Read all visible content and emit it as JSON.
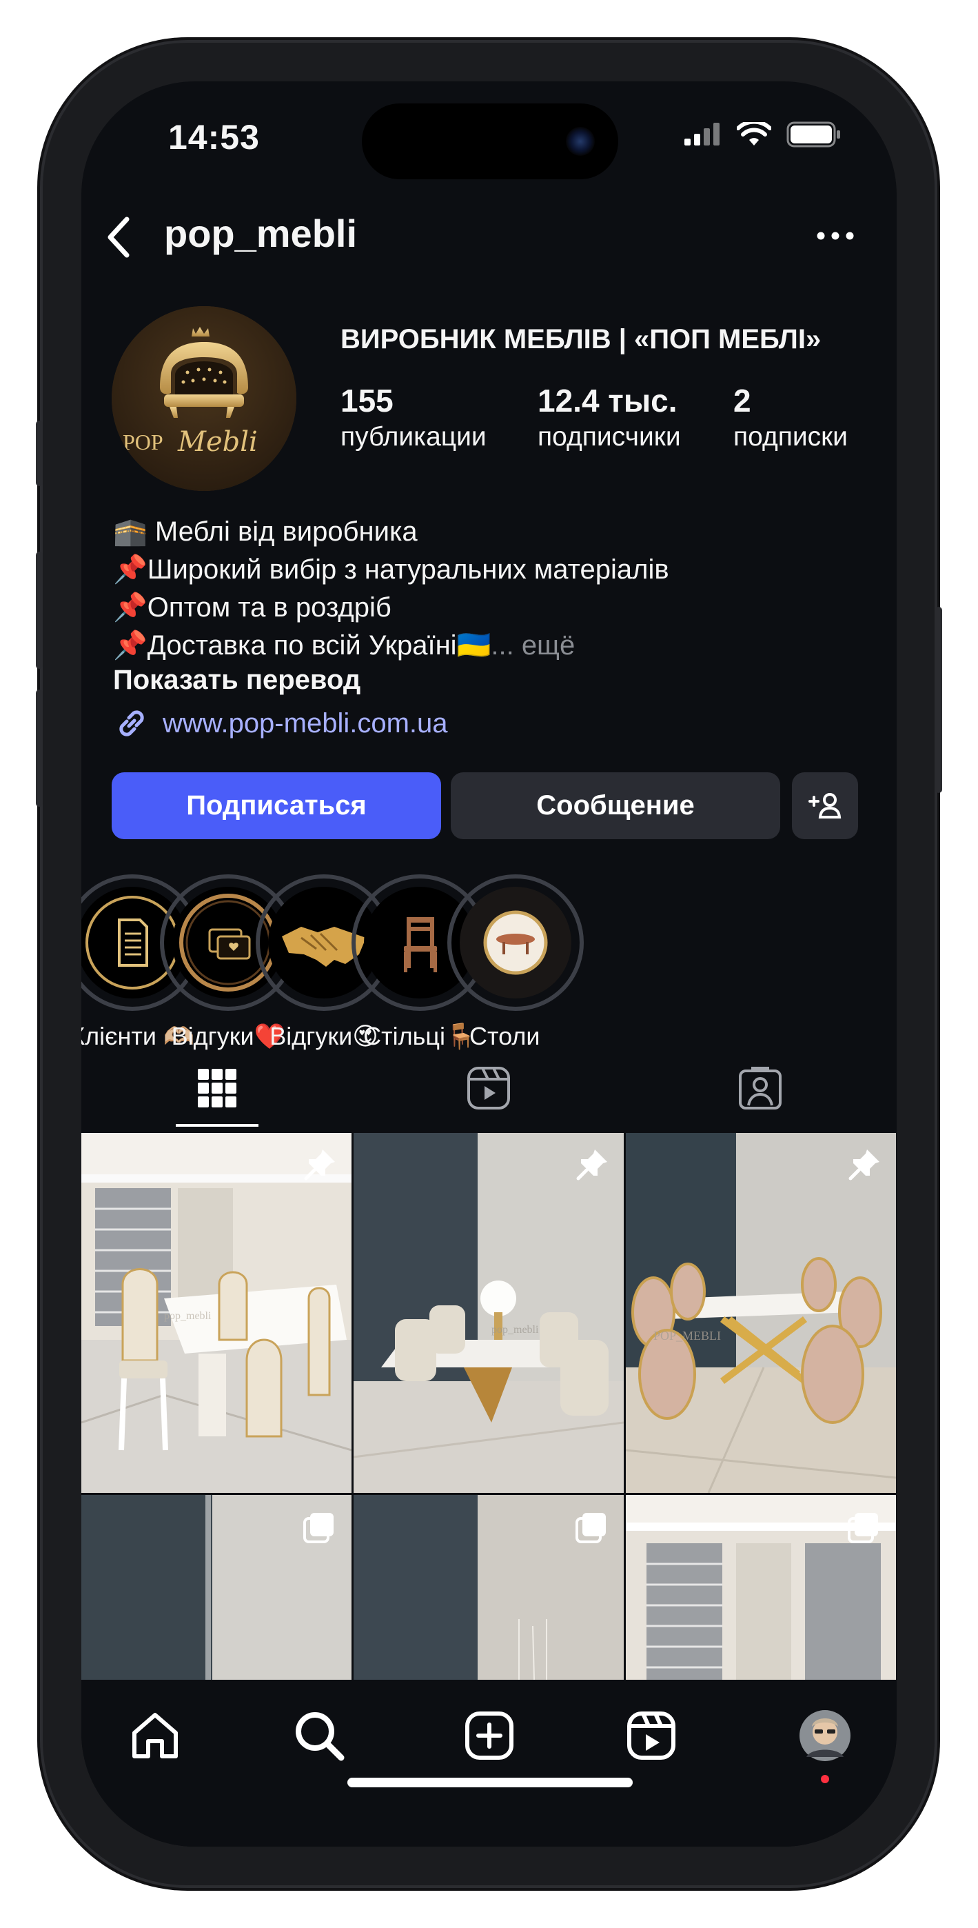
{
  "status": {
    "time": "14:53"
  },
  "header": {
    "username": "pop_mebli"
  },
  "profile": {
    "logo_text": "POP Mebli",
    "name": "ВИРОБНИК МЕБЛІВ | «ПОП МЕБЛІ»",
    "stats": [
      {
        "value": "155",
        "label": "публикации"
      },
      {
        "value": "12.4 тыс.",
        "label": "подписчики"
      },
      {
        "value": "2",
        "label": "подписки"
      }
    ],
    "bio": [
      "🕋 Меблі від виробника",
      "📌Широкий вибір з натуральних матеріалів",
      "📌Оптом та в роздріб",
      "📌Доставка по всій Україні🇺🇦"
    ],
    "bio_more": "... ещё",
    "translate": "Показать перевод",
    "link": "www.pop-mebli.com.ua"
  },
  "actions": {
    "follow": "Подписаться",
    "message": "Сообщение",
    "add_user_icon": "add-person"
  },
  "highlights": [
    {
      "label": "Клієнти 🫶🏼",
      "icon": "document"
    },
    {
      "label": "Відгуки❤️",
      "icon": "chat-heart"
    },
    {
      "label": "Відгуки😍",
      "icon": "handshake"
    },
    {
      "label": "Стільці🪑",
      "icon": "chair"
    },
    {
      "label": "Столи",
      "icon": "table"
    }
  ],
  "tabs": [
    "grid",
    "reels",
    "tagged"
  ],
  "posts": [
    {
      "badge": "pinned",
      "watermark": "pop_mebli"
    },
    {
      "badge": "pinned",
      "watermark": "pop_mebli"
    },
    {
      "badge": "pinned",
      "watermark": "POP_MEBLI"
    },
    {
      "badge": "carousel",
      "watermark": ""
    },
    {
      "badge": "carousel",
      "watermark": ""
    },
    {
      "badge": "carousel",
      "watermark": ""
    }
  ],
  "bottom_nav": [
    "home",
    "search",
    "create",
    "reels",
    "profile"
  ],
  "colors": {
    "background": "#0c0e12",
    "accent": "#4a5df9",
    "button": "#2a2c33",
    "link": "#a7b0ff",
    "gold": "#c9a35a"
  }
}
